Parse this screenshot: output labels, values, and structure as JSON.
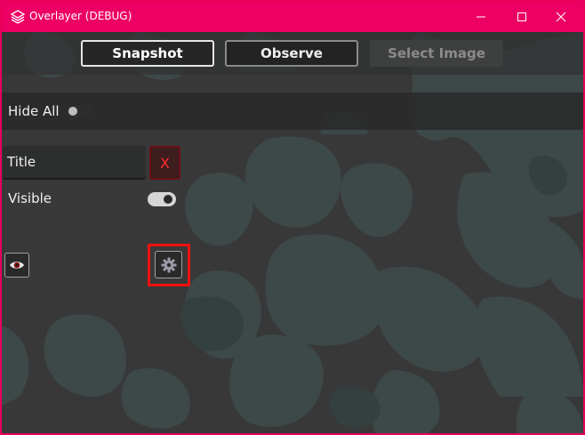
{
  "window": {
    "title": "Overlayer (DEBUG)",
    "accent_color": "#ec0063",
    "controls": {
      "minimize_icon": "minimize-icon",
      "maximize_icon": "maximize-icon",
      "close_icon": "close-icon"
    }
  },
  "toolbar": {
    "buttons": [
      {
        "label": "Snapshot",
        "state": "active"
      },
      {
        "label": "Observe",
        "state": "normal"
      },
      {
        "label": "Select Image",
        "state": "disabled"
      }
    ]
  },
  "hide_all": {
    "label": "Hide All",
    "checked": false
  },
  "overlay_item": {
    "title_value": "Title",
    "remove_label": "X",
    "visible_label": "Visible",
    "visible_checked": true,
    "eye_icon": "eye-icon",
    "settings_icon": "gear-icon"
  }
}
